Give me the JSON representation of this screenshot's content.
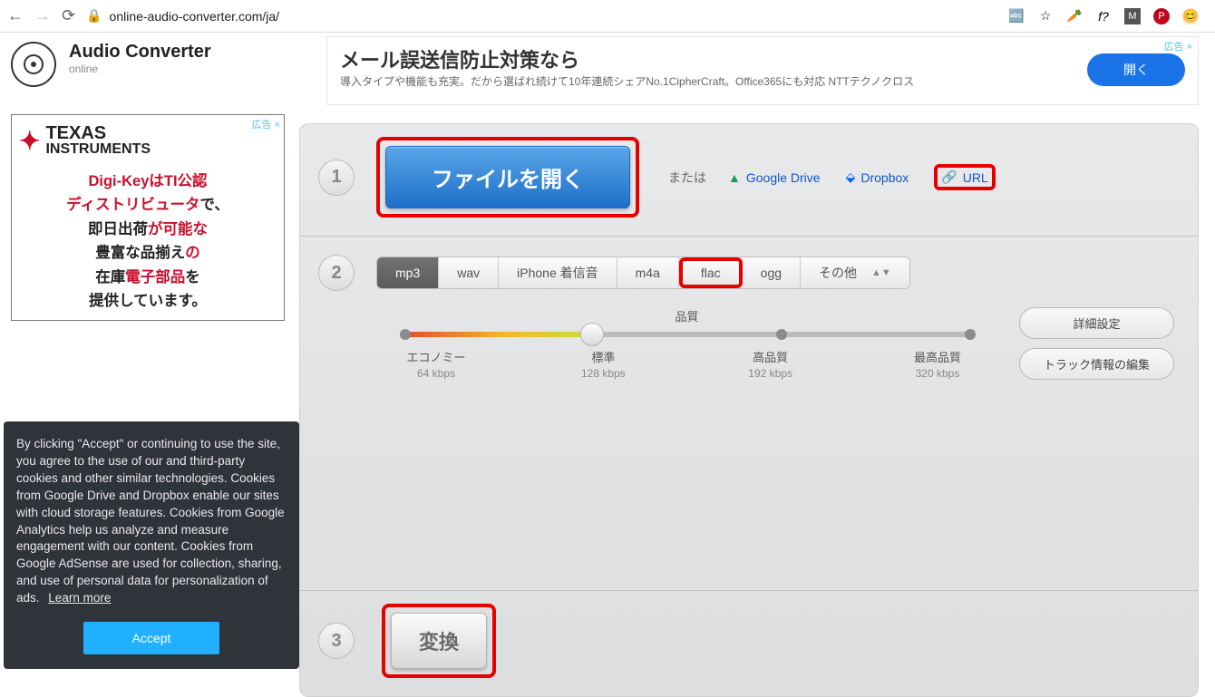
{
  "browser": {
    "url": "online-audio-converter.com/ja/",
    "ext_icons": [
      "translate",
      "star",
      "carrot",
      "f?",
      "M",
      "P",
      "avatar"
    ]
  },
  "app": {
    "title": "Audio Converter",
    "subtitle": "online"
  },
  "ad_top": {
    "corner": "広告 ×",
    "headline": "メール誤送信防止対策なら",
    "desc": "導入タイプや機能も充実。だから選ばれ続けて10年連続シェアNo.1CipherCraft。Office365にも対応 NTTテクノクロス",
    "open": "開く"
  },
  "ad_side": {
    "label": "広告 ×",
    "brand1": "TEXAS",
    "brand2": "INSTRUMENTS",
    "line1a": "Digi-KeyはTI公認",
    "line2a": "ディストリビュータ",
    "line2b": "で、",
    "line3a": "即日出荷",
    "line3b": "が可能な",
    "line4a": "豊富な品揃え",
    "line4b": "の",
    "line5a": "在庫",
    "line5b": "電子部品",
    "line5c": "を",
    "line6": "提供しています。"
  },
  "step1": {
    "num": "1",
    "open_file": "ファイルを開く",
    "or": "または",
    "gdrive": "Google Drive",
    "dropbox": "Dropbox",
    "url": "URL"
  },
  "step2": {
    "num": "2",
    "formats": [
      "mp3",
      "wav",
      "iPhone 着信音",
      "m4a",
      "flac",
      "ogg",
      "その他"
    ],
    "quality_title": "品質",
    "labels": [
      "エコノミー",
      "標準",
      "高品質",
      "最高品質"
    ],
    "rates": [
      "64 kbps",
      "128 kbps",
      "192 kbps",
      "320 kbps"
    ],
    "adv": "詳細設定",
    "track": "トラック情報の編集"
  },
  "step3": {
    "num": "3",
    "convert": "変換"
  },
  "cookie": {
    "text": "By clicking \"Accept\" or continuing to use the site, you agree to the use of our and third-party cookies and other similar technologies. Cookies from Google Drive and Dropbox enable our sites with cloud storage features. Cookies from Google Analytics help us analyze and measure engagement with our content. Cookies from Google AdSense are used for collection, sharing, and use of personal data for personalization of ads.",
    "learn": "Learn more",
    "accept": "Accept"
  }
}
